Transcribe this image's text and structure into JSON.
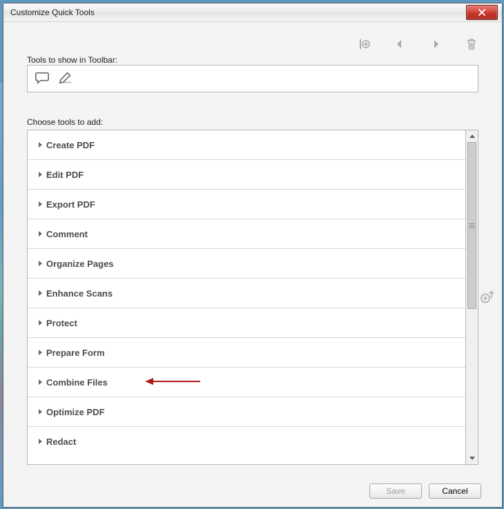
{
  "title": "Customize Quick Tools",
  "labels": {
    "toolbar": "Tools to show in Toolbar:",
    "choose": "Choose tools to add:"
  },
  "toolbar_items": [
    {
      "icon": "comment-icon"
    },
    {
      "icon": "pencil-icon"
    }
  ],
  "controls": {
    "add_divider": "add-divider-icon",
    "move_left": "arrow-left-icon",
    "move_right": "arrow-right-icon",
    "delete": "trash-icon",
    "move_up": "add-up-icon"
  },
  "categories": [
    "Create PDF",
    "Edit PDF",
    "Export PDF",
    "Comment",
    "Organize Pages",
    "Enhance Scans",
    "Protect",
    "Prepare Form",
    "Combine Files",
    "Optimize PDF",
    "Redact"
  ],
  "annotation": {
    "target_index": 7
  },
  "buttons": {
    "save": "Save",
    "cancel": "Cancel"
  }
}
